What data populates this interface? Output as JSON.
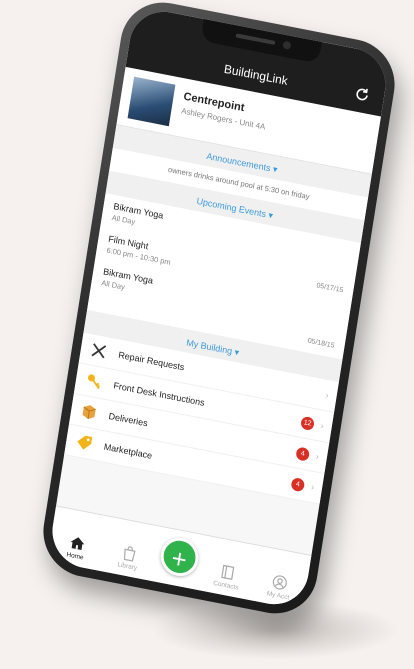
{
  "app": {
    "title": "BuildingLink"
  },
  "building": {
    "name": "Centrepoint",
    "resident": "Ashley Rogers - Unit 4A"
  },
  "announcements": {
    "heading": "Announcements",
    "text": "owners drinks around pool at 5:30 on friday"
  },
  "events": {
    "heading": "Upcoming Events",
    "items": [
      {
        "name": "Bikram Yoga",
        "time": "All Day",
        "date": ""
      },
      {
        "name": "Film Night",
        "time": "6:00 pm - 10:30 pm",
        "date": "05/17/15"
      },
      {
        "name": "Bikram Yoga",
        "time": "All Day",
        "date": ""
      }
    ],
    "trailing_date": "05/18/15"
  },
  "my_building": {
    "heading": "My Building",
    "items": [
      {
        "label": "Repair Requests",
        "badge": "",
        "icon": "wrench-screwdriver-icon"
      },
      {
        "label": "Front Desk Instructions",
        "badge": "12",
        "icon": "key-icon"
      },
      {
        "label": "Deliveries",
        "badge": "4",
        "icon": "package-icon"
      },
      {
        "label": "Marketplace",
        "badge": "4",
        "icon": "tag-icon"
      }
    ]
  },
  "tabbar": {
    "items": [
      {
        "label": "Home",
        "icon": "home-icon",
        "active": true
      },
      {
        "label": "Library",
        "icon": "bag-icon",
        "active": false
      },
      {
        "label": "Contacts",
        "icon": "book-icon",
        "active": false
      },
      {
        "label": "My Acct",
        "icon": "user-icon",
        "active": false
      }
    ],
    "fab_symbol": "+"
  },
  "colors": {
    "header_bg": "#1e1e1e",
    "accent_blue": "#3b9ad9",
    "badge_red": "#d93025",
    "fab_green": "#2fb34a",
    "background": "#f6f1ee"
  }
}
